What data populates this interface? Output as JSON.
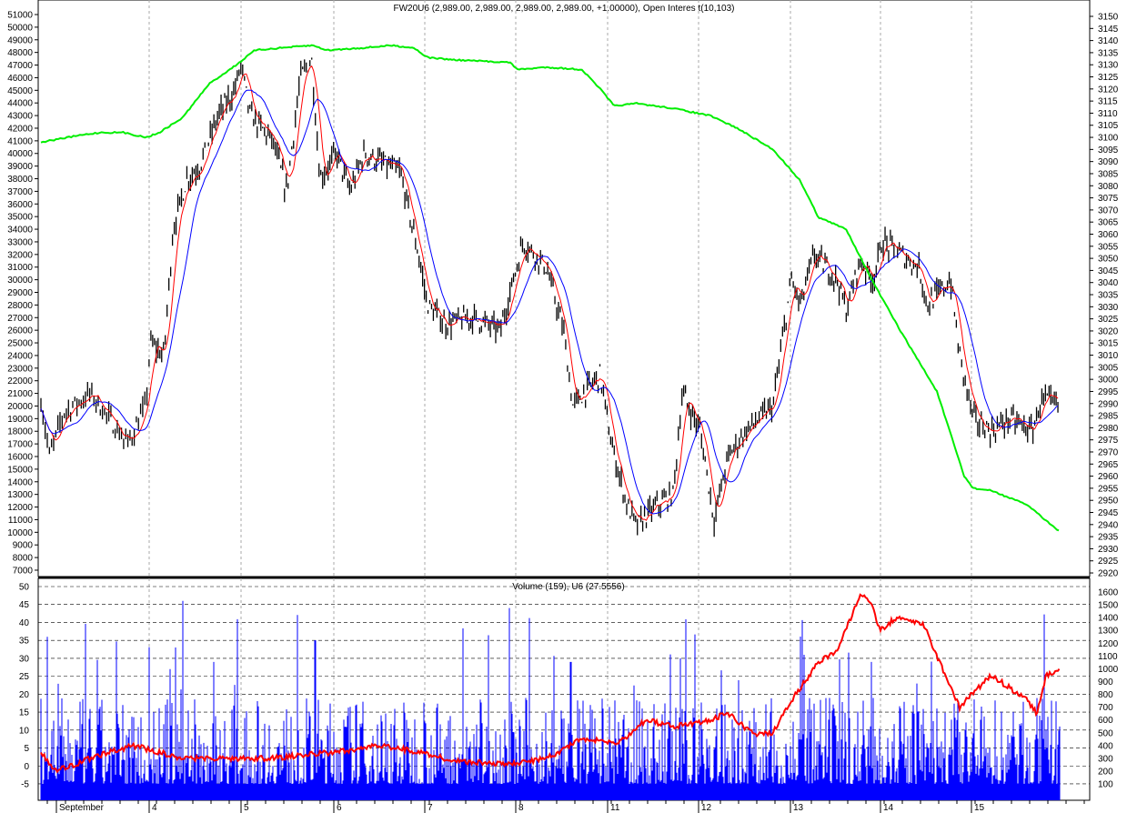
{
  "chart_data": [
    {
      "type": "line",
      "title": "FW20U6 (2,989.00, 2,989.00, 2,989.00, 2,989.00, +1.00000), Open Interes t(10,103)",
      "x_categories": [
        "September",
        "4",
        "5",
        "6",
        "7",
        "8",
        "11",
        "12",
        "13",
        "14",
        "15"
      ],
      "left_axis": {
        "min": 7000,
        "max": 51000,
        "step": 1000
      },
      "right_axis": {
        "min": 2920,
        "max": 3150,
        "step": 5
      },
      "colors": {
        "price": "#000000",
        "ma_fast": "#ff0000",
        "ma_slow": "#0000ff",
        "open_interest": "#00ee00"
      },
      "series": [
        {
          "name": "Open Interest",
          "axis": "left",
          "style": "ohlc-bars",
          "points": [
            [
              0,
              20500
            ],
            [
              0.08,
              16000
            ],
            [
              0.21,
              19500
            ],
            [
              0.46,
              21000
            ],
            [
              0.8,
              17000
            ],
            [
              0.97,
              20000
            ],
            [
              1.01,
              25000
            ],
            [
              1.16,
              24000
            ],
            [
              1.26,
              34000
            ],
            [
              1.41,
              38000
            ],
            [
              1.55,
              39000
            ],
            [
              1.75,
              43000
            ],
            [
              1.93,
              45000
            ],
            [
              2,
              47000
            ],
            [
              2.1,
              43000
            ],
            [
              2.34,
              41000
            ],
            [
              2.49,
              37000
            ],
            [
              2.64,
              46000
            ],
            [
              2.76,
              47500
            ],
            [
              2.85,
              38000
            ],
            [
              3.03,
              40000
            ],
            [
              3.18,
              37000
            ],
            [
              3.33,
              40000
            ],
            [
              3.73,
              38500
            ],
            [
              3.93,
              32000
            ],
            [
              4.03,
              28000
            ],
            [
              4.23,
              26500
            ],
            [
              4.53,
              27000
            ],
            [
              4.83,
              26000
            ],
            [
              5.08,
              33000
            ],
            [
              5.33,
              31000
            ],
            [
              5.52,
              26000
            ],
            [
              5.62,
              20000
            ],
            [
              5.92,
              22500
            ],
            [
              6.04,
              17000
            ],
            [
              6.22,
              12000
            ],
            [
              6.32,
              10500
            ],
            [
              6.52,
              12000
            ],
            [
              6.72,
              13000
            ],
            [
              6.82,
              21000
            ],
            [
              7.02,
              18000
            ],
            [
              7.17,
              11000
            ],
            [
              7.32,
              16000
            ],
            [
              7.51,
              18000
            ],
            [
              7.81,
              20000
            ],
            [
              8.01,
              30000
            ],
            [
              8.11,
              28000
            ],
            [
              8.26,
              32000
            ],
            [
              8.52,
              30000
            ],
            [
              8.62,
              27500
            ],
            [
              8.77,
              31500
            ],
            [
              8.92,
              30000
            ],
            [
              9.02,
              33000
            ],
            [
              9.22,
              32000
            ],
            [
              9.42,
              31000
            ],
            [
              9.52,
              28000
            ],
            [
              9.77,
              30000
            ],
            [
              9.87,
              24000
            ],
            [
              10.02,
              19000
            ],
            [
              10.22,
              18000
            ],
            [
              10.42,
              19000
            ],
            [
              10.67,
              18000
            ],
            [
              10.77,
              20500
            ],
            [
              10.97,
              20000
            ]
          ]
        },
        {
          "name": "FW20U6",
          "axis": "right",
          "style": "line",
          "points": [
            [
              0,
              3098
            ],
            [
              0.38,
              3101
            ],
            [
              0.55,
              3102
            ],
            [
              0.76,
              3102
            ],
            [
              0.97,
              3100
            ],
            [
              1.11,
              3102
            ],
            [
              1.36,
              3108
            ],
            [
              1.65,
              3122
            ],
            [
              1.95,
              3130
            ],
            [
              2.15,
              3136
            ],
            [
              2.44,
              3137
            ],
            [
              2.77,
              3138
            ],
            [
              2.93,
              3136
            ],
            [
              3.33,
              3137
            ],
            [
              3.63,
              3138
            ],
            [
              3.88,
              3137
            ],
            [
              4.03,
              3133
            ],
            [
              4.33,
              3132
            ],
            [
              4.93,
              3131
            ],
            [
              5.03,
              3128
            ],
            [
              5.33,
              3129
            ],
            [
              5.72,
              3128
            ],
            [
              5.92,
              3120
            ],
            [
              6.07,
              3113
            ],
            [
              6.32,
              3114
            ],
            [
              6.72,
              3112
            ],
            [
              7.12,
              3109
            ],
            [
              7.41,
              3104
            ],
            [
              7.81,
              3095
            ],
            [
              8.11,
              3082
            ],
            [
              8.31,
              3067
            ],
            [
              8.62,
              3062
            ],
            [
              8.92,
              3040
            ],
            [
              9.22,
              3020
            ],
            [
              9.62,
              2995
            ],
            [
              9.92,
              2960
            ],
            [
              10.02,
              2955
            ],
            [
              10.22,
              2954
            ],
            [
              10.62,
              2948
            ],
            [
              10.97,
              2937
            ]
          ]
        }
      ]
    },
    {
      "type": "bar",
      "title": "Volume (159), U6 (27.5556)",
      "left_axis": {
        "min": -5,
        "max": 50,
        "step": 5
      },
      "right_axis": {
        "min": 100,
        "max": 1600,
        "step": 100
      },
      "colors": {
        "volume": "#0000ff",
        "open_interest": "#ff0000"
      },
      "volume_spikes": [
        [
          0.06,
          36
        ],
        [
          0.16,
          14
        ],
        [
          1.23,
          27
        ],
        [
          1.37,
          46
        ],
        [
          1.7,
          29
        ],
        [
          2.8,
          35
        ],
        [
          4.93,
          44
        ],
        [
          5.6,
          29
        ],
        [
          6.8,
          30
        ],
        [
          8.15,
          31
        ],
        [
          8.9,
          29
        ],
        [
          10.97,
          11
        ]
      ],
      "volume_baseline": 8,
      "series": [
        {
          "name": "U6",
          "axis": "right",
          "style": "line",
          "points": [
            [
              0,
              350
            ],
            [
              0.13,
              200
            ],
            [
              0.46,
              300
            ],
            [
              0.84,
              400
            ],
            [
              1.36,
              300
            ],
            [
              2.34,
              300
            ],
            [
              3.03,
              350
            ],
            [
              3.53,
              400
            ],
            [
              3.93,
              350
            ],
            [
              4.33,
              280
            ],
            [
              4.93,
              250
            ],
            [
              5.33,
              300
            ],
            [
              5.72,
              450
            ],
            [
              6.12,
              420
            ],
            [
              6.42,
              600
            ],
            [
              6.72,
              550
            ],
            [
              7.12,
              600
            ],
            [
              7.32,
              650
            ],
            [
              7.61,
              480
            ],
            [
              7.81,
              500
            ],
            [
              8.01,
              750
            ],
            [
              8.31,
              1050
            ],
            [
              8.52,
              1150
            ],
            [
              8.67,
              1400
            ],
            [
              8.77,
              1560
            ],
            [
              8.87,
              1550
            ],
            [
              9,
              1300
            ],
            [
              9.17,
              1400
            ],
            [
              9.47,
              1350
            ],
            [
              9.62,
              1100
            ],
            [
              9.87,
              700
            ],
            [
              10,
              800
            ],
            [
              10.22,
              950
            ],
            [
              10.42,
              850
            ],
            [
              10.62,
              750
            ],
            [
              10.72,
              650
            ],
            [
              10.82,
              950
            ],
            [
              10.97,
              1000
            ]
          ]
        }
      ]
    }
  ]
}
